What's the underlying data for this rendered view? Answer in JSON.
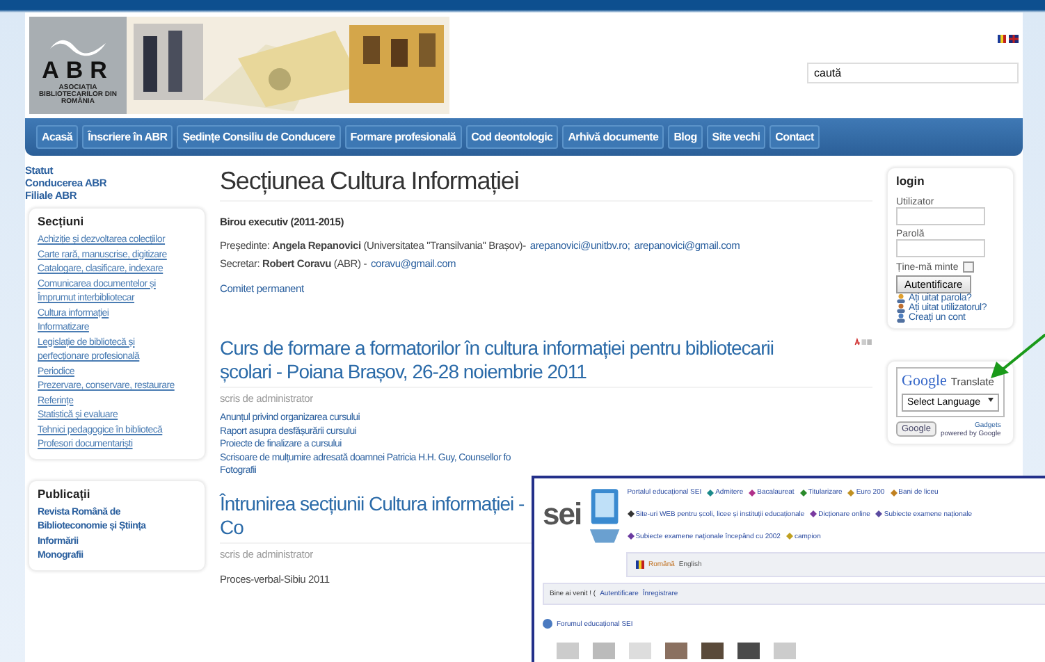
{
  "header": {
    "logo_text": "ABR",
    "logo_subtitle": "ASOCIAȚIA BIBLIOTECARILOR DIN ROMÂNIA",
    "search": {
      "value": "caută"
    }
  },
  "nav": [
    "Acasă",
    "Înscriere în ABR",
    "Ședințe Consiliu de Conducere",
    "Formare profesională",
    "Cod deontologic",
    "Arhivă documente",
    "Blog",
    "Site vechi",
    "Contact"
  ],
  "sidebar": {
    "top_links": [
      "Statut",
      "Conducerea ABR",
      "Filiale ABR"
    ],
    "sections": {
      "title": "Secțiuni",
      "items": [
        "Achiziție și dezvoltarea colecțiilor",
        "Carte rară, manuscrise, digitizare",
        "Catalogare, clasificare, indexare",
        "Comunicarea documentelor și",
        "Împrumut interbibliotecar",
        "Cultura informației",
        "Informatizare",
        "Legislație de bibliotecă și",
        "perfecționare profesională",
        "Periodice",
        "Prezervare, conservare, restaurare",
        "Referințe",
        "Statistică și evaluare",
        "Tehnici pedagogice în bibliotecă",
        "Profesori documentariști"
      ]
    },
    "publications": {
      "title": "Publicații",
      "items": [
        "Revista Română de",
        "Biblioteconomie și Știința",
        "Informării",
        "Monografii"
      ]
    }
  },
  "main": {
    "title": "Secțiunea Cultura Informației",
    "board_heading": "Birou executiv (2011-2015)",
    "president": {
      "text": "Președinte: **Angela Repanovici** (Universitatea \"Transilvania\" Brașov)-",
      "emails": [
        "arepanovici@unitbv.ro;",
        "arepanovici@gmail.com"
      ]
    },
    "secretary": {
      "text": "Secretar: **Robert Coravu** (ABR) -",
      "emails": [
        "coravu@gmail.com"
      ]
    },
    "committee_link": "Comitet permanent",
    "articles": [
      {
        "title": "Curs de formare a formatorilor în cultura informației pentru bibliotecarii școlari - Poiana Brașov, 26-28 noiembrie 2011",
        "author": "scris de administrator",
        "links": [
          "Anunțul privind organizarea cursului",
          "Raport asupra desfășurării cursului",
          "Proiecte de finalizare a cursului",
          "Scrisoare de mulțumire adresată doamnei Patricia H.H. Guy, Counsellor fo",
          "Fotografii"
        ],
        "tools": true
      },
      {
        "title": "Întrunirea secțiunii Cultura informației - Co",
        "author": "scris de administrator",
        "paragraph": "Proces-verbal-Sibiu 2011",
        "tools": false
      }
    ]
  },
  "login": {
    "title": "login",
    "user_label": "Utilizator",
    "password_label": "Parolă",
    "remember_label": "Ține-mă minte",
    "remember_checked": false,
    "button": "Autentificare",
    "links": [
      "Ați uitat parola?",
      "Ați uitat utilizatorul?",
      "Creați un cont"
    ]
  },
  "translate": {
    "brand": "Google",
    "label": "Translate",
    "select": "Select Language",
    "button": "Google",
    "gadgets_link": "Gadgets",
    "powered": "powered by Google"
  },
  "overlay": {
    "logo": "sei",
    "links": [
      "Portalul educațional SEI",
      "Admitere",
      "Bacalaureat",
      "Titularizare",
      "Euro 200",
      "Bani de liceu",
      "Site-uri WEB pentru școli, licee și instituții educaționale",
      "Dicționare online",
      "Subiecte examene naționale",
      "Subiecte examene naționale începând cu 2002",
      "campion"
    ],
    "languages": [
      "Română",
      "English"
    ],
    "welcome": "Bine ai venit ! (",
    "welcome_links": [
      "Autentificare",
      "Înregistrare"
    ],
    "forum": "Forumul educațional SEI"
  }
}
